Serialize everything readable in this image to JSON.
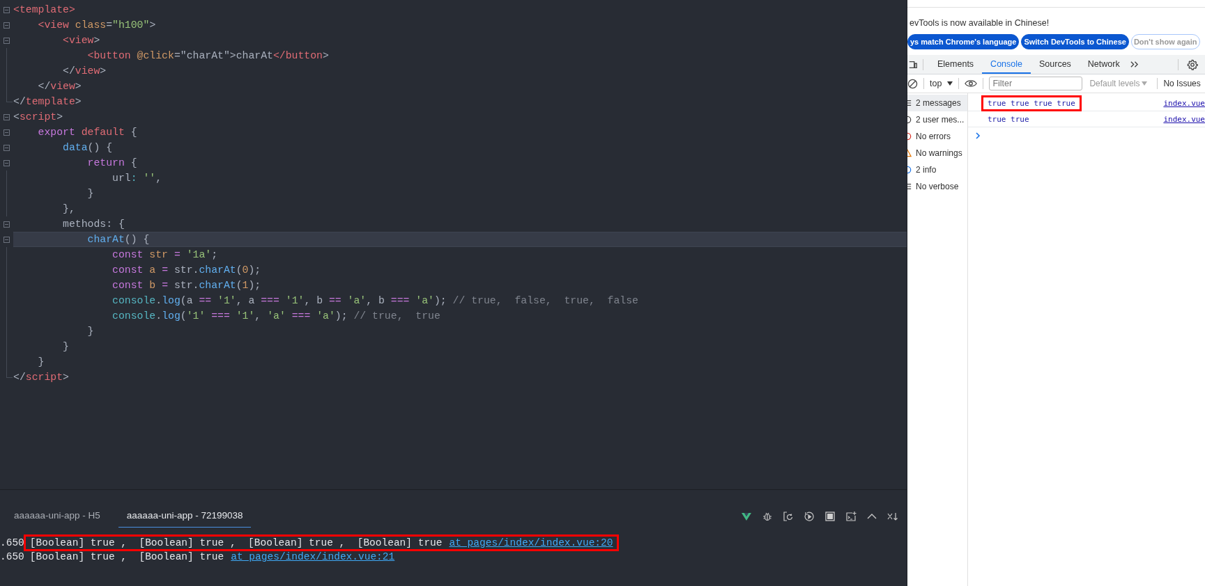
{
  "editor": {
    "lines": [
      {
        "kind": "fold",
        "current": false,
        "tokens": [
          {
            "kind": "tag",
            "t": "<template>"
          }
        ]
      },
      {
        "kind": "fold",
        "current": false,
        "tokens": [
          {
            "kind": "tag",
            "t": "    <view "
          },
          {
            "kind": "attr",
            "t": "class"
          },
          {
            "kind": "plain",
            "t": "="
          },
          {
            "kind": "string",
            "t": "\"h100\""
          },
          {
            "kind": "plain",
            "t": ">"
          }
        ]
      },
      {
        "kind": "fold",
        "current": false,
        "tokens": [
          {
            "kind": "tag",
            "t": "        <view"
          },
          {
            "kind": "plain",
            "t": ">"
          }
        ]
      },
      {
        "kind": "guide",
        "current": false,
        "tokens": [
          {
            "kind": "tag",
            "t": "            <button "
          },
          {
            "kind": "attr",
            "t": "@click"
          },
          {
            "kind": "plain",
            "t": "=\"charAt\">charAt"
          },
          {
            "kind": "tag",
            "t": "</button"
          },
          {
            "kind": "plain",
            "t": ">"
          }
        ]
      },
      {
        "kind": "guide",
        "current": false,
        "tokens": [
          {
            "kind": "plain",
            "t": "        </"
          },
          {
            "kind": "tag",
            "t": "view"
          },
          {
            "kind": "plain",
            "t": ">"
          }
        ]
      },
      {
        "kind": "guide",
        "current": false,
        "tokens": [
          {
            "kind": "plain",
            "t": "    </"
          },
          {
            "kind": "tag",
            "t": "view"
          },
          {
            "kind": "plain",
            "t": ">"
          }
        ]
      },
      {
        "kind": "end",
        "current": false,
        "tokens": [
          {
            "kind": "plain",
            "t": "</"
          },
          {
            "kind": "tag",
            "t": "template"
          },
          {
            "kind": "plain",
            "t": ">"
          }
        ]
      },
      {
        "kind": "fold",
        "current": false,
        "tokens": [
          {
            "kind": "plain",
            "t": "<"
          },
          {
            "kind": "tag",
            "t": "script"
          },
          {
            "kind": "plain",
            "t": ">"
          }
        ]
      },
      {
        "kind": "fold",
        "current": false,
        "tokens": [
          {
            "kind": "keyword",
            "t": "    export "
          },
          {
            "kind": "tag",
            "t": "default "
          },
          {
            "kind": "plain",
            "t": "{"
          }
        ]
      },
      {
        "kind": "fold",
        "current": false,
        "tokens": [
          {
            "kind": "func",
            "t": "        data"
          },
          {
            "kind": "plain",
            "t": "() {"
          }
        ]
      },
      {
        "kind": "fold",
        "current": false,
        "tokens": [
          {
            "kind": "keyword",
            "t": "            return "
          },
          {
            "kind": "plain",
            "t": "{"
          }
        ]
      },
      {
        "kind": "guide",
        "current": false,
        "tokens": [
          {
            "kind": "plain",
            "t": "                url"
          },
          {
            "kind": "cyan",
            "t": ": "
          },
          {
            "kind": "string",
            "t": "''"
          },
          {
            "kind": "plain",
            "t": ","
          }
        ]
      },
      {
        "kind": "guide",
        "current": false,
        "tokens": [
          {
            "kind": "plain",
            "t": "            }"
          }
        ]
      },
      {
        "kind": "guide",
        "current": false,
        "tokens": [
          {
            "kind": "plain",
            "t": "        },"
          }
        ]
      },
      {
        "kind": "fold",
        "current": false,
        "tokens": [
          {
            "kind": "plain",
            "t": "        methods: {"
          }
        ]
      },
      {
        "kind": "fold",
        "current": true,
        "tokens": [
          {
            "kind": "func",
            "t": "            charAt"
          },
          {
            "kind": "plain",
            "t": "() {"
          }
        ]
      },
      {
        "kind": "guide",
        "current": false,
        "tokens": [
          {
            "kind": "keyword",
            "t": "                const "
          },
          {
            "kind": "attr",
            "t": "str"
          },
          {
            "kind": "keyword",
            "t": " = "
          },
          {
            "kind": "string",
            "t": "'1a'"
          },
          {
            "kind": "plain",
            "t": ";"
          }
        ]
      },
      {
        "kind": "guide",
        "current": false,
        "tokens": [
          {
            "kind": "keyword",
            "t": "                const "
          },
          {
            "kind": "attr",
            "t": "a"
          },
          {
            "kind": "keyword",
            "t": " = "
          },
          {
            "kind": "plain",
            "t": "str."
          },
          {
            "kind": "func",
            "t": "charAt"
          },
          {
            "kind": "plain",
            "t": "("
          },
          {
            "kind": "attr",
            "t": "0"
          },
          {
            "kind": "plain",
            "t": ");"
          }
        ]
      },
      {
        "kind": "guide",
        "current": false,
        "tokens": [
          {
            "kind": "keyword",
            "t": "                const "
          },
          {
            "kind": "attr",
            "t": "b"
          },
          {
            "kind": "keyword",
            "t": " = "
          },
          {
            "kind": "plain",
            "t": "str."
          },
          {
            "kind": "func",
            "t": "charAt"
          },
          {
            "kind": "plain",
            "t": "("
          },
          {
            "kind": "attr",
            "t": "1"
          },
          {
            "kind": "plain",
            "t": ");"
          }
        ]
      },
      {
        "kind": "guide",
        "current": false,
        "tokens": [
          {
            "kind": "cyan",
            "t": "                console"
          },
          {
            "kind": "plain",
            "t": "."
          },
          {
            "kind": "func",
            "t": "log"
          },
          {
            "kind": "plain",
            "t": "(a "
          },
          {
            "kind": "keyword",
            "t": "=="
          },
          {
            "kind": "string",
            "t": " '1'"
          },
          {
            "kind": "plain",
            "t": ", a "
          },
          {
            "kind": "keyword",
            "t": "==="
          },
          {
            "kind": "string",
            "t": " '1'"
          },
          {
            "kind": "plain",
            "t": ", b "
          },
          {
            "kind": "keyword",
            "t": "=="
          },
          {
            "kind": "string",
            "t": " 'a'"
          },
          {
            "kind": "plain",
            "t": ", b "
          },
          {
            "kind": "keyword",
            "t": "==="
          },
          {
            "kind": "string",
            "t": " 'a'"
          },
          {
            "kind": "plain",
            "t": ");"
          },
          {
            "kind": "comment",
            "t": " // true,  false,  true,  false"
          }
        ]
      },
      {
        "kind": "guide",
        "current": false,
        "tokens": [
          {
            "kind": "cyan",
            "t": "                console"
          },
          {
            "kind": "plain",
            "t": "."
          },
          {
            "kind": "func",
            "t": "log"
          },
          {
            "kind": "plain",
            "t": "("
          },
          {
            "kind": "string",
            "t": "'1'"
          },
          {
            "kind": "keyword",
            "t": " ==="
          },
          {
            "kind": "string",
            "t": " '1'"
          },
          {
            "kind": "plain",
            "t": ", "
          },
          {
            "kind": "string",
            "t": "'a'"
          },
          {
            "kind": "keyword",
            "t": " ==="
          },
          {
            "kind": "string",
            "t": " 'a'"
          },
          {
            "kind": "plain",
            "t": ");"
          },
          {
            "kind": "comment",
            "t": " // true,  true"
          }
        ]
      },
      {
        "kind": "guide",
        "current": false,
        "tokens": [
          {
            "kind": "plain",
            "t": "            }"
          }
        ]
      },
      {
        "kind": "guide",
        "current": false,
        "tokens": [
          {
            "kind": "plain",
            "t": "        }"
          }
        ]
      },
      {
        "kind": "guide",
        "current": false,
        "tokens": [
          {
            "kind": "plain",
            "t": "    }"
          }
        ]
      },
      {
        "kind": "end",
        "current": false,
        "tokens": [
          {
            "kind": "plain",
            "t": "</"
          },
          {
            "kind": "tag",
            "t": "script"
          },
          {
            "kind": "plain",
            "t": ">"
          }
        ]
      }
    ]
  },
  "bottom_panel": {
    "tabs": [
      {
        "label": "aaaaaa-uni-app - H5",
        "selected": false
      },
      {
        "label": "aaaaaa-uni-app - 72199038",
        "selected": true
      }
    ],
    "log": [
      {
        "time": ".650",
        "message": "[Boolean] true ,  [Boolean] true ,  [Boolean] true ,  [Boolean] true",
        "link": "at pages/index/index.vue:20",
        "highlighted": true
      },
      {
        "time": ".650",
        "message": "[Boolean] true ,  [Boolean] true",
        "link": "at pages/index/index.vue:21",
        "highlighted": false
      }
    ]
  },
  "devtools": {
    "banner": {
      "text": "evTools is now available in Chinese!",
      "buttons": [
        {
          "label": "ys match Chrome's language",
          "kind": "primary"
        },
        {
          "label": "Switch DevTools to Chinese",
          "kind": "primary"
        },
        {
          "label": "Don't show again",
          "kind": "outline"
        }
      ]
    },
    "tabs": [
      {
        "label": "Elements",
        "selected": false
      },
      {
        "label": "Console",
        "selected": true
      },
      {
        "label": "Sources",
        "selected": false
      },
      {
        "label": "Network",
        "selected": false
      }
    ],
    "toolbar": {
      "context": "top",
      "filter": {
        "placeholder": "Filter"
      },
      "levels": "Default levels",
      "issues": "No Issues"
    },
    "sidebar": [
      {
        "label": "2 messages",
        "selected": true
      },
      {
        "label": "2 user mes...",
        "selected": false
      },
      {
        "label": "No errors",
        "selected": false
      },
      {
        "label": "No warnings",
        "selected": false
      },
      {
        "label": "2 info",
        "selected": false
      },
      {
        "label": "No verbose",
        "selected": false
      }
    ],
    "messages": [
      {
        "text": "true true true true",
        "source": "index.vue",
        "highlighted": true
      },
      {
        "text": "true true",
        "source": "index.vue",
        "highlighted": false
      }
    ]
  }
}
